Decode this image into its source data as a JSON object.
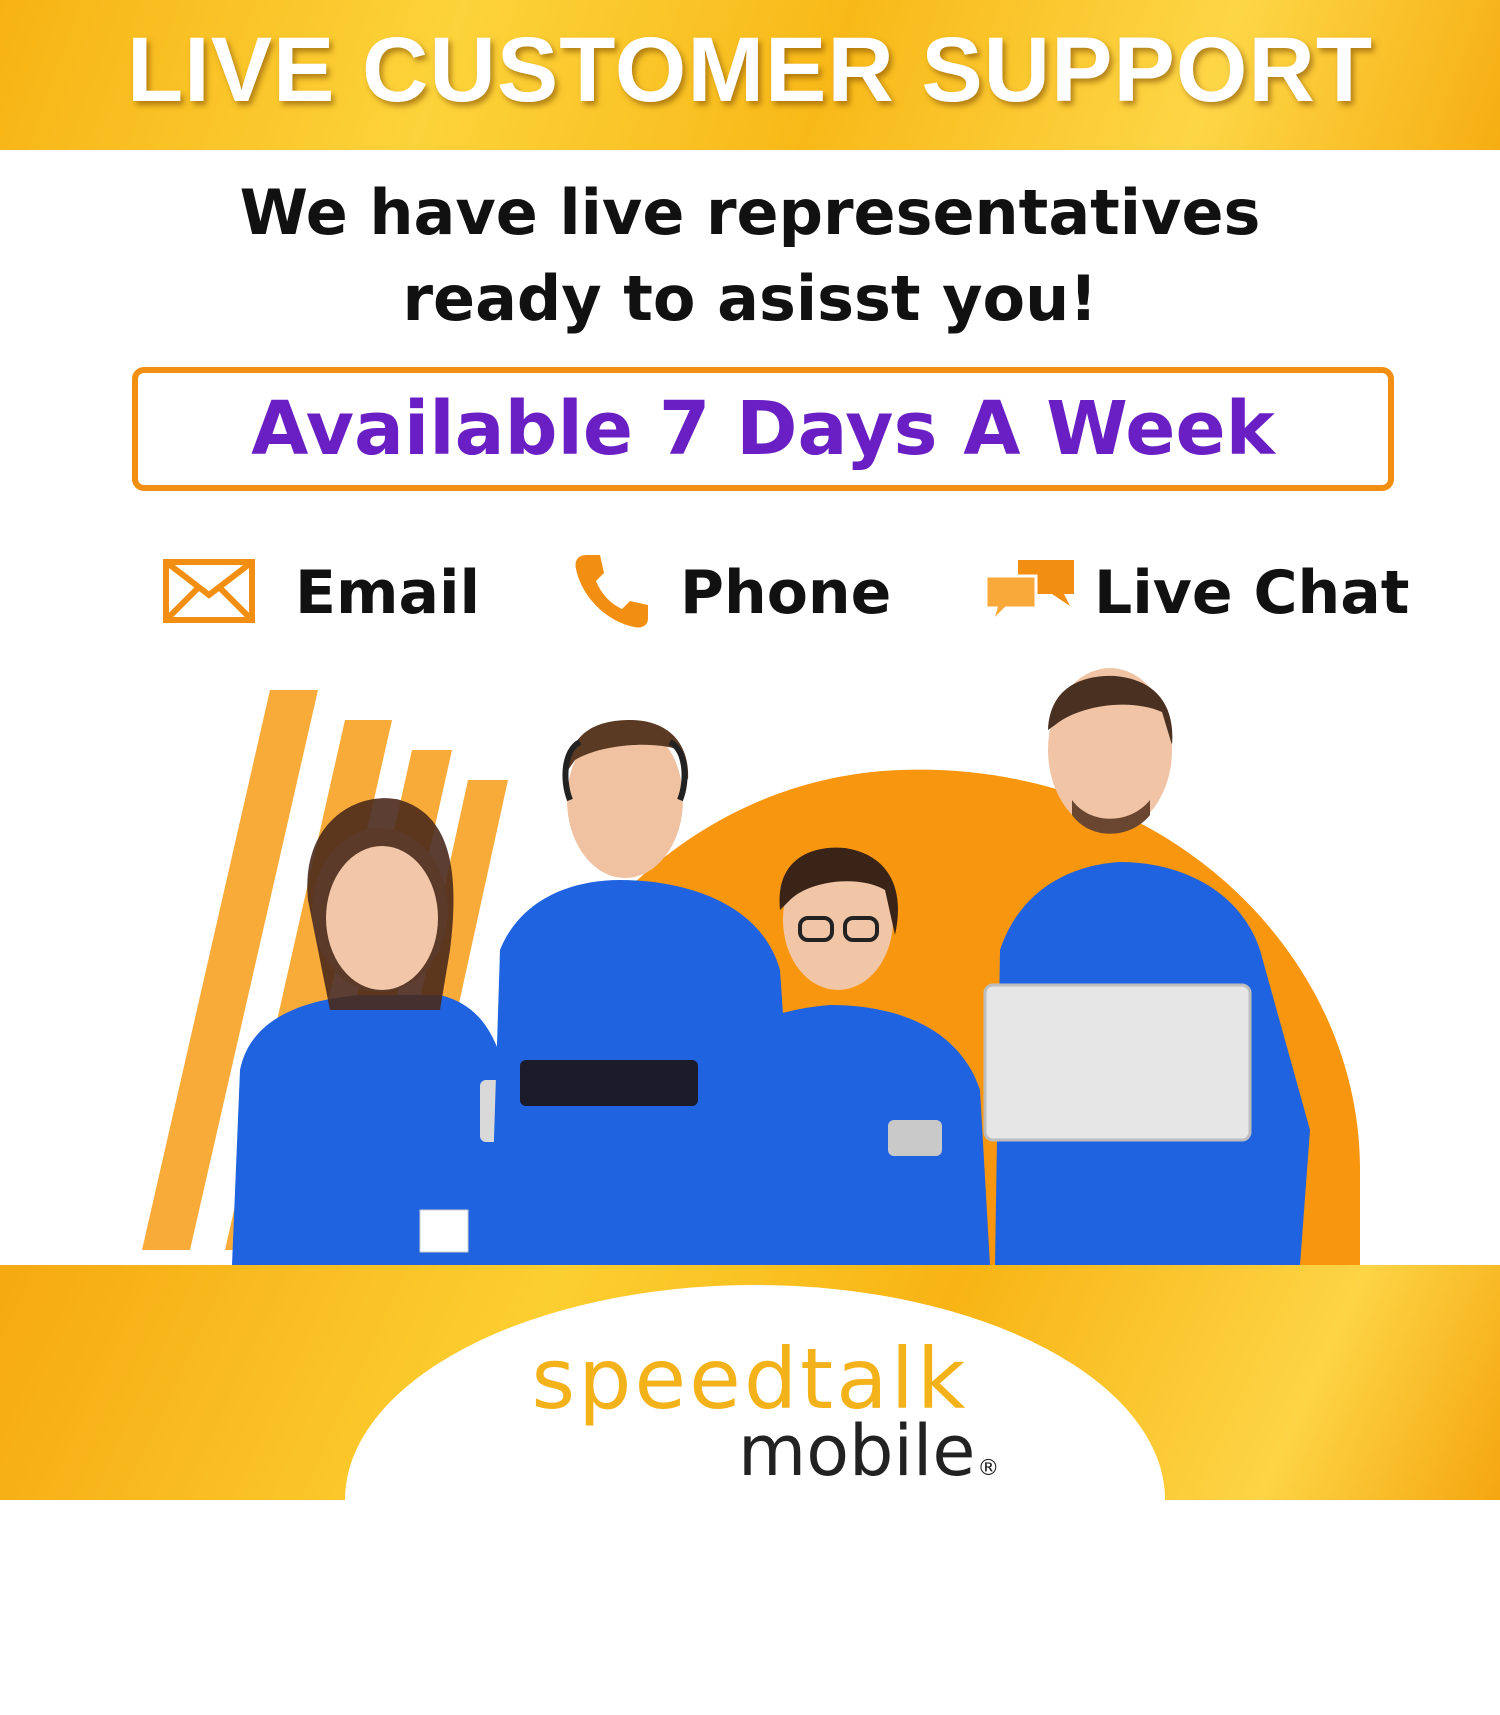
{
  "header": {
    "title": "LIVE CUSTOMER SUPPORT"
  },
  "subtitle": {
    "line1": "We have live representatives",
    "line2": "ready to asisst you!"
  },
  "availability": {
    "text": "Available 7 Days A Week"
  },
  "channels": [
    {
      "label": "Email",
      "icon": "envelope-icon"
    },
    {
      "label": "Phone",
      "icon": "phone-icon"
    },
    {
      "label": "Live Chat",
      "icon": "chat-bubbles-icon"
    }
  ],
  "logo": {
    "brand": "speedtalk",
    "sub": "mobile",
    "mark": "®"
  },
  "colors": {
    "accent_orange": "#f28f13",
    "accent_purple": "#6a1fc4",
    "gold": "#f8b918",
    "shirt_blue": "#1f63e0"
  }
}
